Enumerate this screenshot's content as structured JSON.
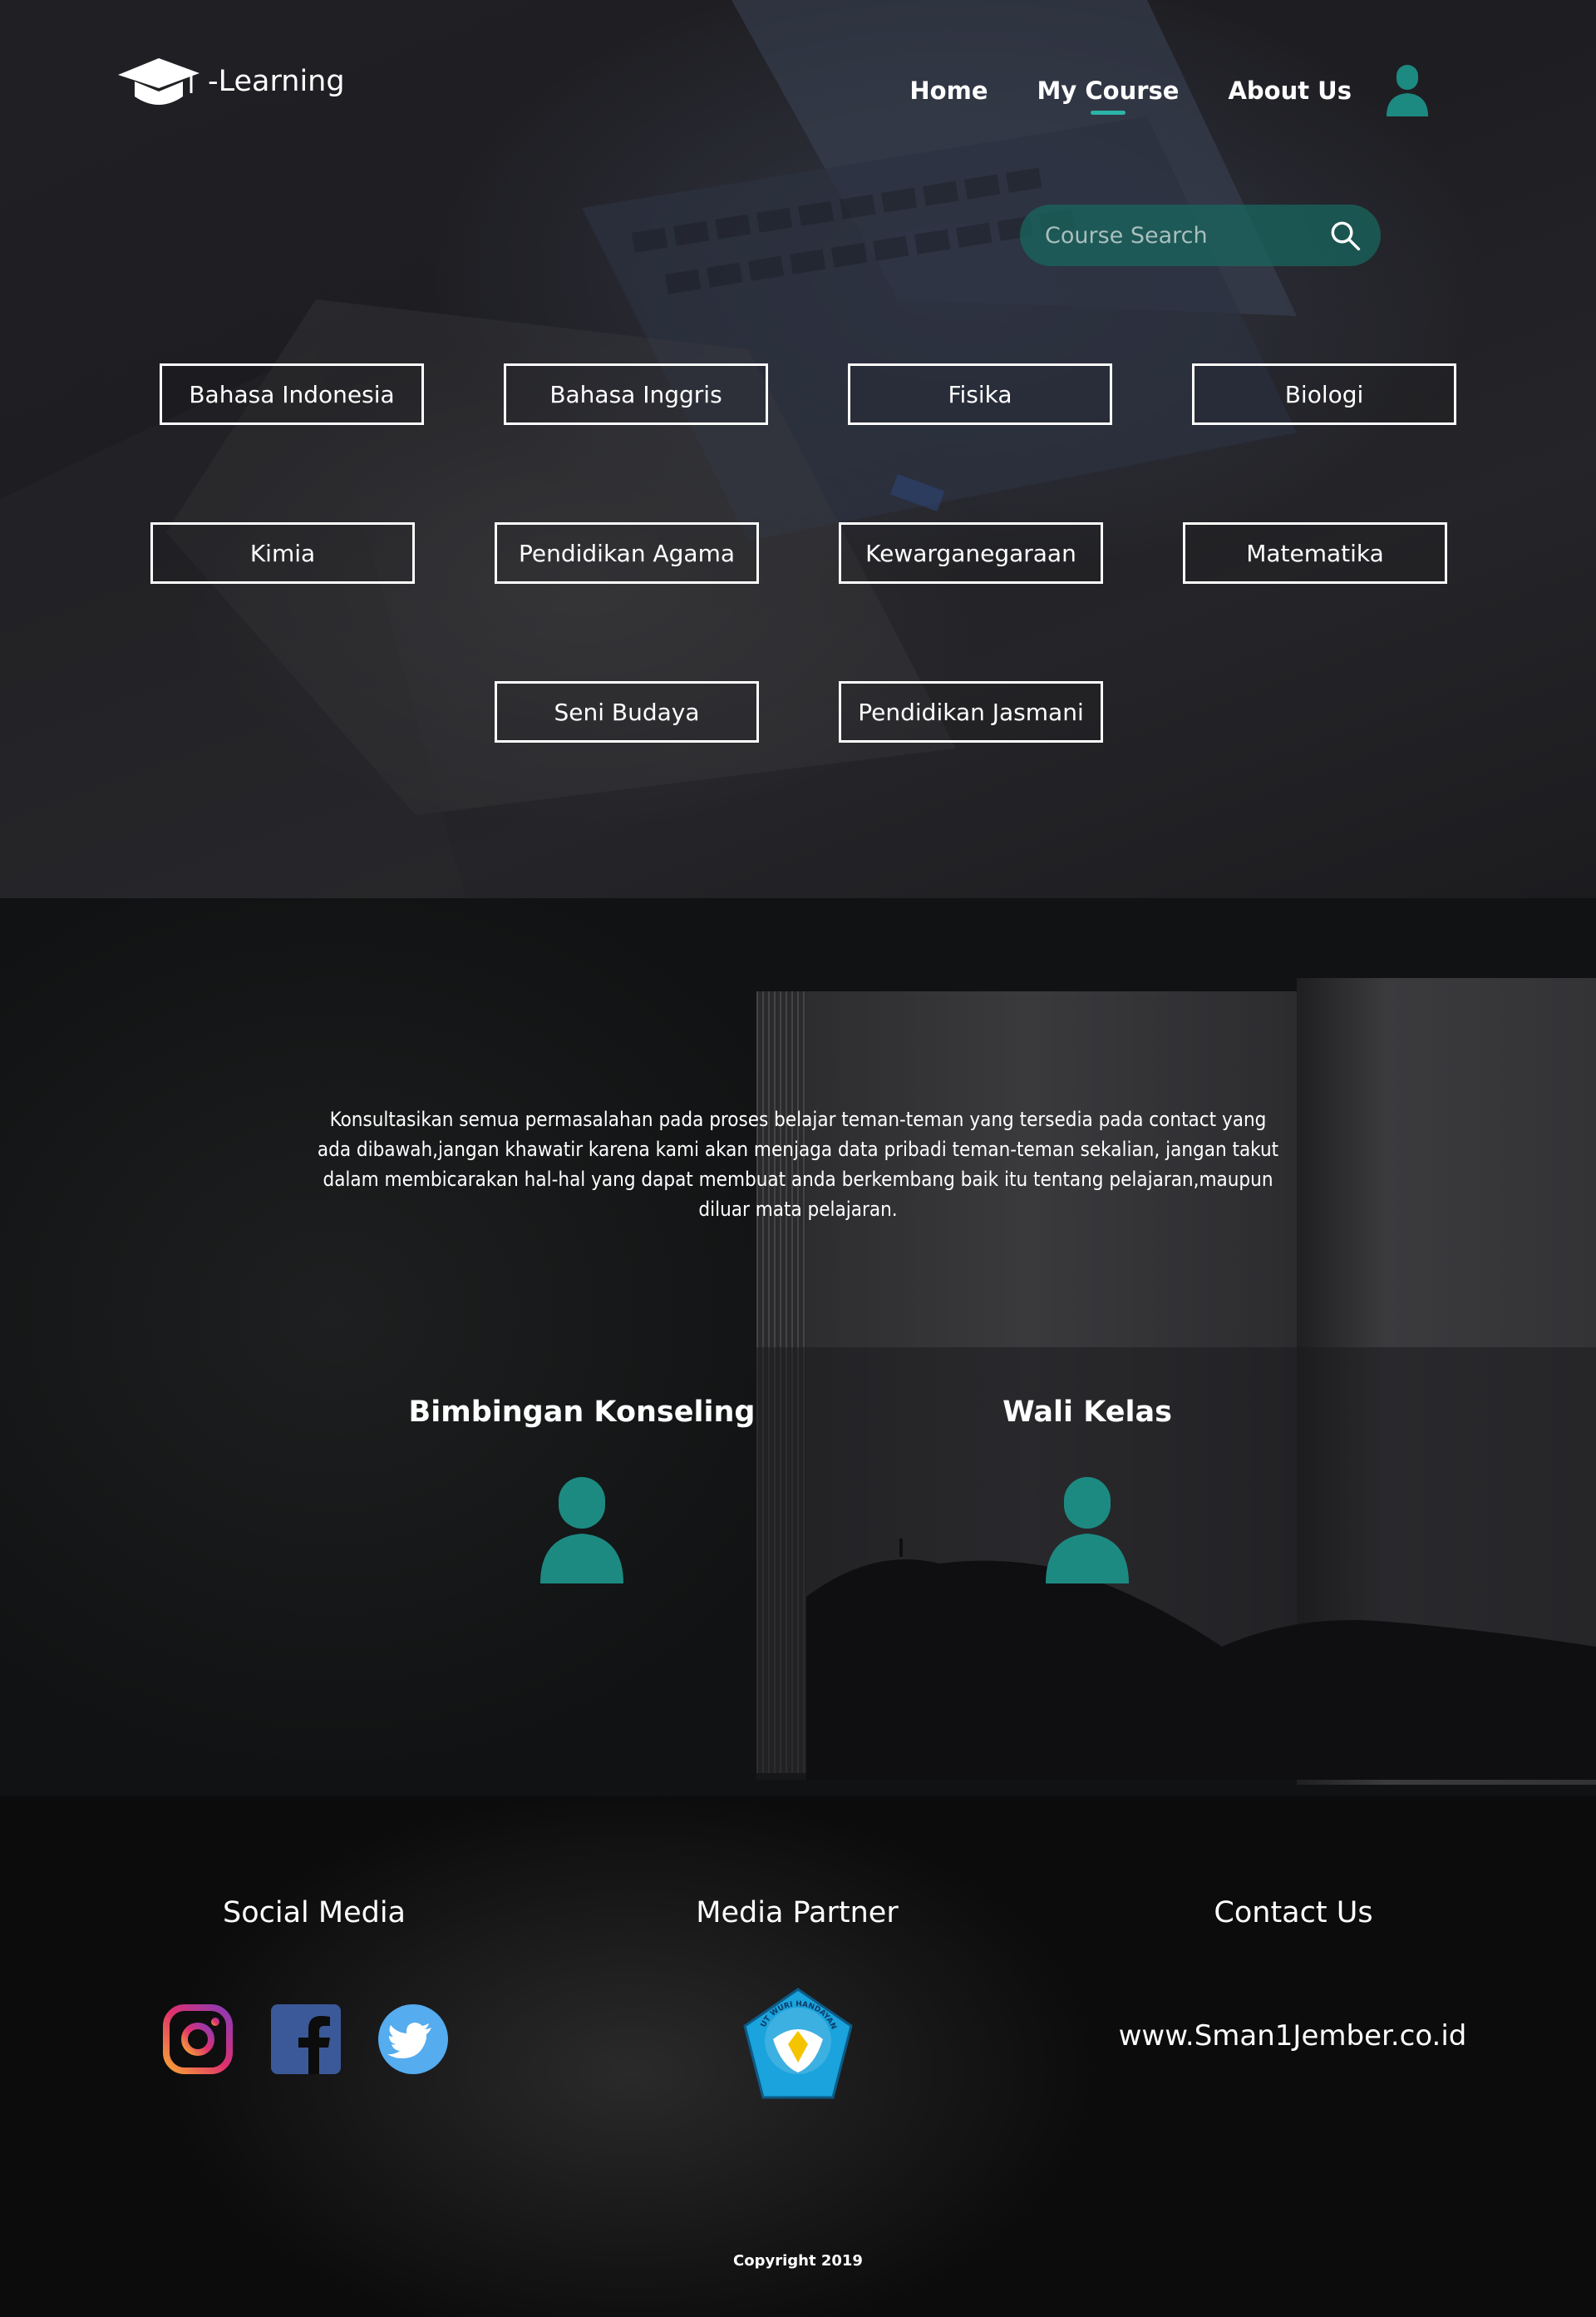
{
  "header": {
    "logo_text": "-Learning",
    "nav": [
      {
        "label": "Home",
        "active": false
      },
      {
        "label": "My Course",
        "active": true
      },
      {
        "label": "About Us",
        "active": false
      }
    ]
  },
  "search": {
    "placeholder": "Course Search"
  },
  "courses": [
    "Bahasa Indonesia",
    "Bahasa Inggris",
    "Fisika",
    "Biologi",
    "Kimia",
    "Pendidikan Agama",
    "Kewarganegaraan",
    "Matematika",
    "Seni Budaya",
    "Pendidikan Jasmani"
  ],
  "consult": {
    "description": "Konsultasikan semua permasalahan pada proses belajar teman-teman yang tersedia pada contact yang ada dibawah,jangan khawatir karena kami akan menjaga data pribadi teman-teman sekalian, jangan takut dalam membicarakan hal-hal yang dapat membuat anda berkembang baik itu tentang pelajaran,maupun diluar mata pelajaran.",
    "contacts": [
      {
        "title": "Bimbingan Konseling"
      },
      {
        "title": "Wali Kelas"
      }
    ]
  },
  "footer": {
    "social_title": "Social Media",
    "partner_title": "Media Partner",
    "contact_title": "Contact Us",
    "social_icons": [
      "instagram-icon",
      "facebook-icon",
      "twitter-icon"
    ],
    "partner_logo": "tut-wuri-handayani-logo",
    "partner_logo_text": "TUT WURI HANDAYANI",
    "website": "www.Sman1Jember.co.id",
    "copyright": "Copyright 2019"
  },
  "colors": {
    "accent": "#2bb3a7",
    "avatar": "#1d8a82",
    "search_bg": "#186860"
  }
}
